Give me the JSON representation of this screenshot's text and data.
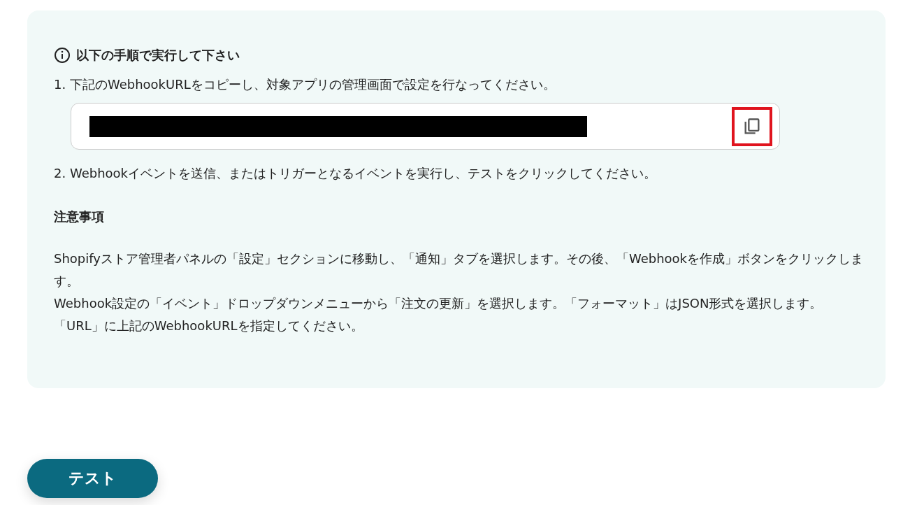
{
  "instructions": {
    "title": "以下の手順で実行して下さい",
    "step_1": "1. 下記のWebhookURLをコピーし、対象アプリの管理画面で設定を行なってください。",
    "url_field": {
      "redacted": true
    },
    "copy_button": {
      "highlighted": true
    },
    "step_2": "2. Webhookイベントを送信、またはトリガーとなるイベントを実行し、テストをクリックしてください。",
    "notes_heading": "注意事項",
    "notes": [
      "Shopifyストア管理者パネルの「設定」セクションに移動し、「通知」タブを選択します。その後、「Webhookを作成」ボタンをクリックします。",
      "Webhook設定の「イベント」ドロップダウンメニューから「注文の更新」を選択します。「フォーマット」はJSON形式を選択します。",
      "「URL」に上記のWebhookURLを指定してください。"
    ]
  },
  "test_button": {
    "label": "テスト"
  }
}
